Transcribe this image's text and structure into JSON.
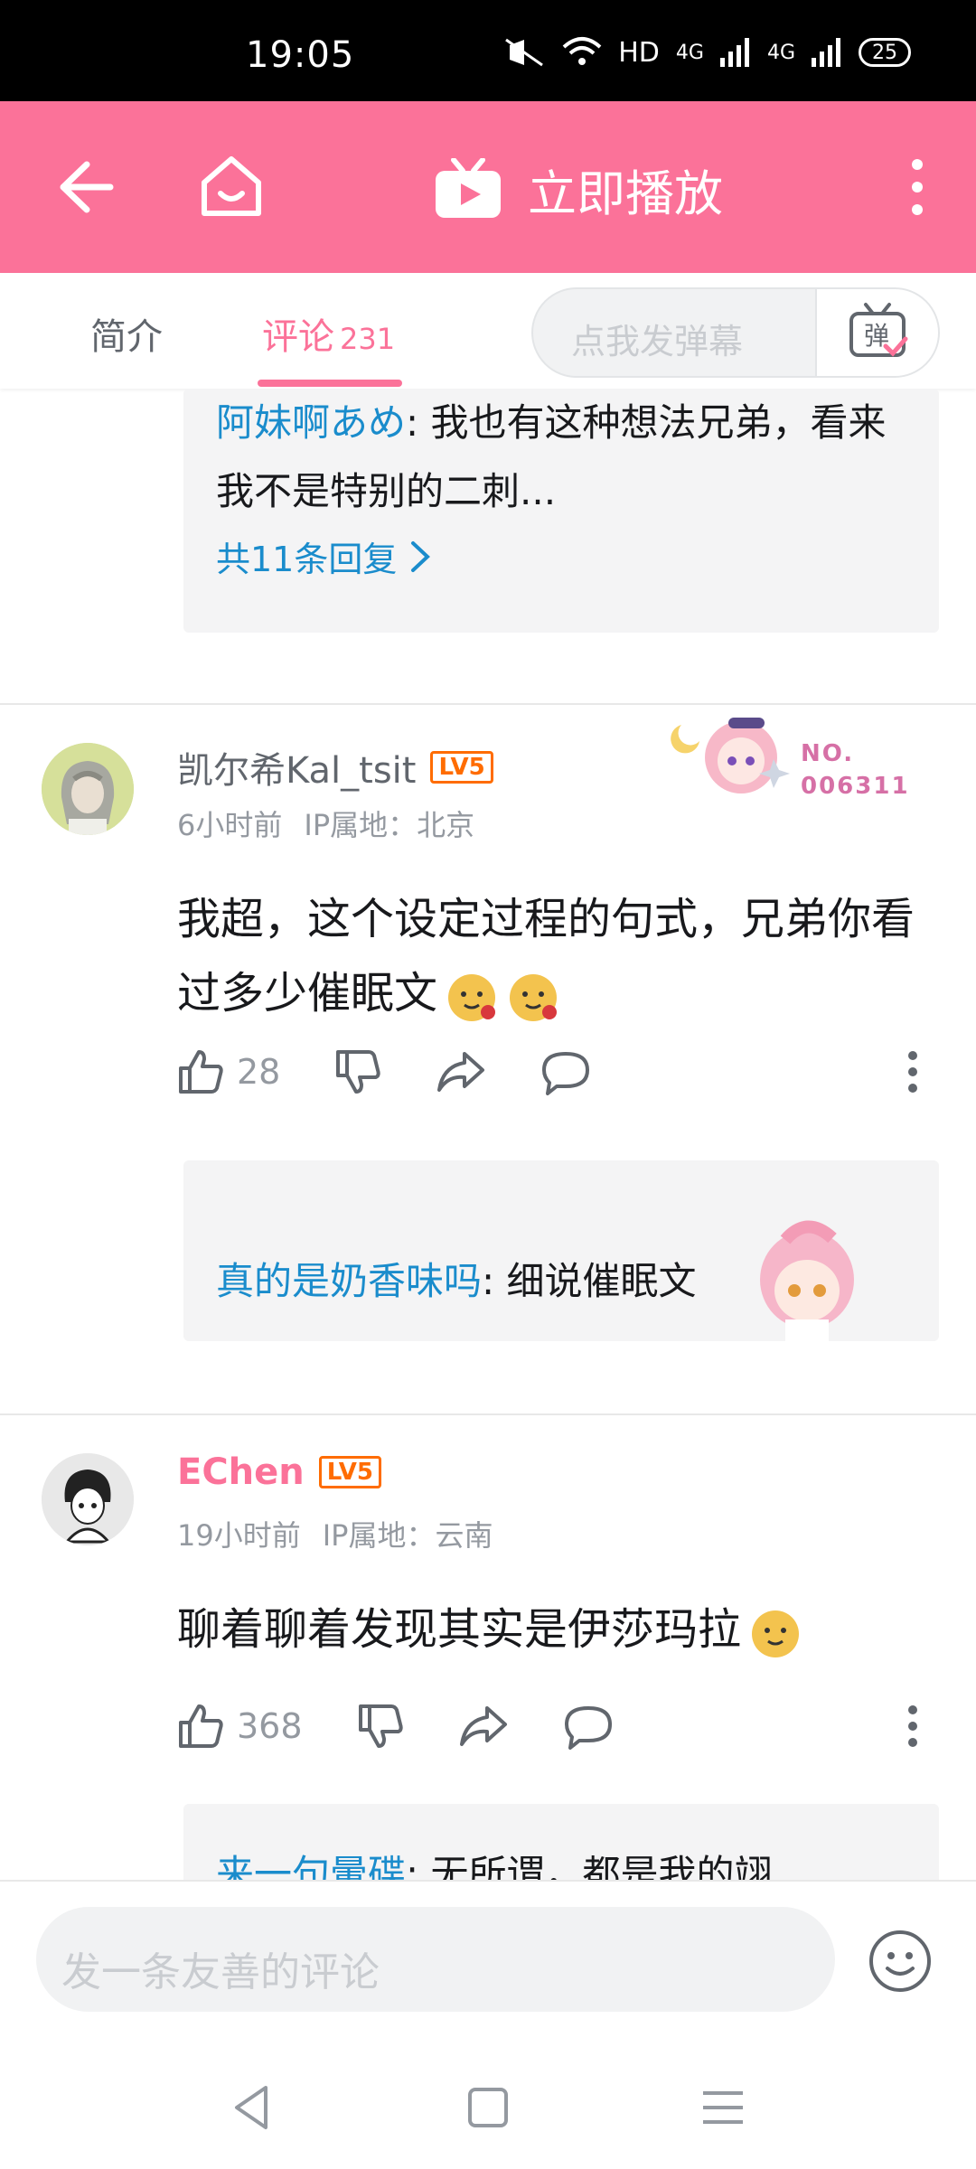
{
  "status_bar": {
    "time": "19:05",
    "network": "HD",
    "signal_1": "4G",
    "signal_2": "4G",
    "battery": "25"
  },
  "app_bar": {
    "play_label": "立即播放"
  },
  "tabs": {
    "intro_label": "简介",
    "comments_label": "评论",
    "comments_count": "231",
    "danmaku_placeholder": "点我发弹幕",
    "danmaku_button": "弹"
  },
  "thread1_reply": {
    "user": "阿妹啊あめ",
    "text": ": 我也有这种想法兄弟，看来我不是特别的二刺...",
    "more_label": "共11条回复"
  },
  "comment1": {
    "username": "凯尔希Kal_tsit",
    "level": "LV5",
    "time": "6小时前",
    "ip": "IP属地：北京",
    "text": "我超，这个设定过程的句式，兄弟你看过多少催眠文",
    "badge_no_label": "NO.",
    "badge_no_value": "006311",
    "likes": "28",
    "reply_user": "真的是奶香味吗",
    "reply_text": ": 细说催眠文"
  },
  "comment2": {
    "username": "EChen",
    "level": "LV5",
    "time": "19小时前",
    "ip": "IP属地：云南",
    "text": "聊着聊着发现其实是伊莎玛拉",
    "likes": "368",
    "reply_user": "来一句暈碟",
    "reply_text": ": 无所谓，都是我的翊"
  },
  "bottom": {
    "comment_placeholder": "发一条友善的评论"
  },
  "colors": {
    "brand": "#fb7299",
    "link": "#1a8ccc",
    "level": "#ff6c00"
  }
}
